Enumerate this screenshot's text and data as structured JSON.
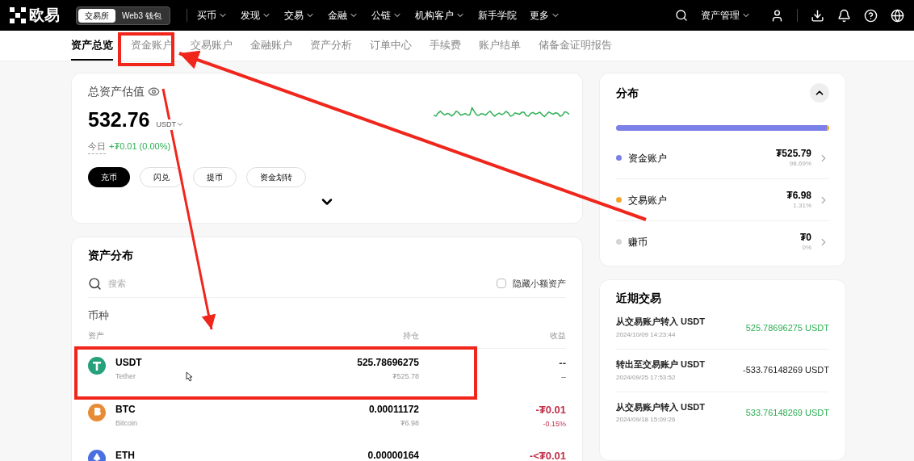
{
  "topbar": {
    "logo": "欧易",
    "mode_tabs": [
      {
        "label": "交易所",
        "selected": true
      },
      {
        "label": "Web3 钱包",
        "selected": false
      }
    ],
    "menu": [
      {
        "label": "买币",
        "dropdown": true
      },
      {
        "label": "发现",
        "dropdown": true
      },
      {
        "label": "交易",
        "dropdown": true
      },
      {
        "label": "金融",
        "dropdown": true
      },
      {
        "label": "公链",
        "dropdown": true
      },
      {
        "label": "机构客户",
        "dropdown": true
      },
      {
        "label": "新手学院",
        "dropdown": false
      },
      {
        "label": "更多",
        "dropdown": true
      }
    ],
    "asset_menu": "资产管理"
  },
  "subnav": [
    {
      "label": "资产总览",
      "selected": true
    },
    {
      "label": "资金账户",
      "selected": false
    },
    {
      "label": "交易账户",
      "selected": false
    },
    {
      "label": "金融账户",
      "selected": false
    },
    {
      "label": "资产分析",
      "selected": false
    },
    {
      "label": "订单中心",
      "selected": false
    },
    {
      "label": "手续费",
      "selected": false
    },
    {
      "label": "账户结单",
      "selected": false
    },
    {
      "label": "储备金证明报告",
      "selected": false
    }
  ],
  "overview": {
    "title": "总资产估值",
    "amount": "532.76",
    "unit": "USDT",
    "today_label": "今日",
    "today_change": "+₮0.01 (0.00%)",
    "actions": [
      {
        "label": "充币",
        "primary": true
      },
      {
        "label": "闪兑",
        "primary": false
      },
      {
        "label": "提币",
        "primary": false
      },
      {
        "label": "资金划转",
        "primary": false
      }
    ]
  },
  "assets": {
    "title": "资产分布",
    "search_placeholder": "搜索",
    "hide_small": {
      "label": "隐藏小额资产",
      "checked": false
    },
    "section": "币种",
    "columns": [
      "资产",
      "持仓",
      "收益"
    ],
    "rows": [
      {
        "symbol": "USDT",
        "name": "Tether",
        "color": "#26a17b",
        "amount": "525.78696275",
        "value": "₮525.78",
        "pnl": {
          "text": "--",
          "pct": "--",
          "color": "#333333"
        }
      },
      {
        "symbol": "BTC",
        "name": "Bitcoin",
        "color": "#e88b35",
        "amount": "0.00011172",
        "value": "₮6.98",
        "pnl": {
          "text": "-₮0.01",
          "pct": "-0.15%",
          "color": "#c0304a"
        }
      },
      {
        "symbol": "ETH",
        "color": "#4a6fe0",
        "amount": "0.00000164",
        "pnl": {
          "text": "-<₮0.01",
          "color": "#c0304a"
        }
      }
    ]
  },
  "distribution": {
    "title": "分布",
    "expanded": true,
    "accounts": [
      {
        "label": "资金账户",
        "color": "#7b7fe8",
        "level": 0.9869,
        "amount": "₮525.79",
        "pct": "98.69%"
      },
      {
        "label": "交易账户",
        "color": "#f0a830",
        "level": 0.0131,
        "amount": "₮6.98",
        "pct": "1.31%"
      },
      {
        "label": "赚币",
        "color": "#d4d4d4",
        "level": 0,
        "amount": "₮0",
        "pct": "0%"
      }
    ]
  },
  "recent": {
    "title": "近期交易",
    "items": [
      {
        "title": "从交易账户转入 USDT",
        "time": "2024/10/09 14:23:44",
        "amount": "525.78696275 USDT",
        "color": "#2eaf55"
      },
      {
        "title": "转出至交易账户 USDT",
        "time": "2024/09/25 17:53:52",
        "amount": "-533.76148269 USDT",
        "color": "#222222"
      },
      {
        "title": "从交易账户转入 USDT",
        "time": "2024/09/18 15:09:26",
        "amount": "533.76148269 USDT",
        "color": "#2eaf55"
      }
    ]
  }
}
